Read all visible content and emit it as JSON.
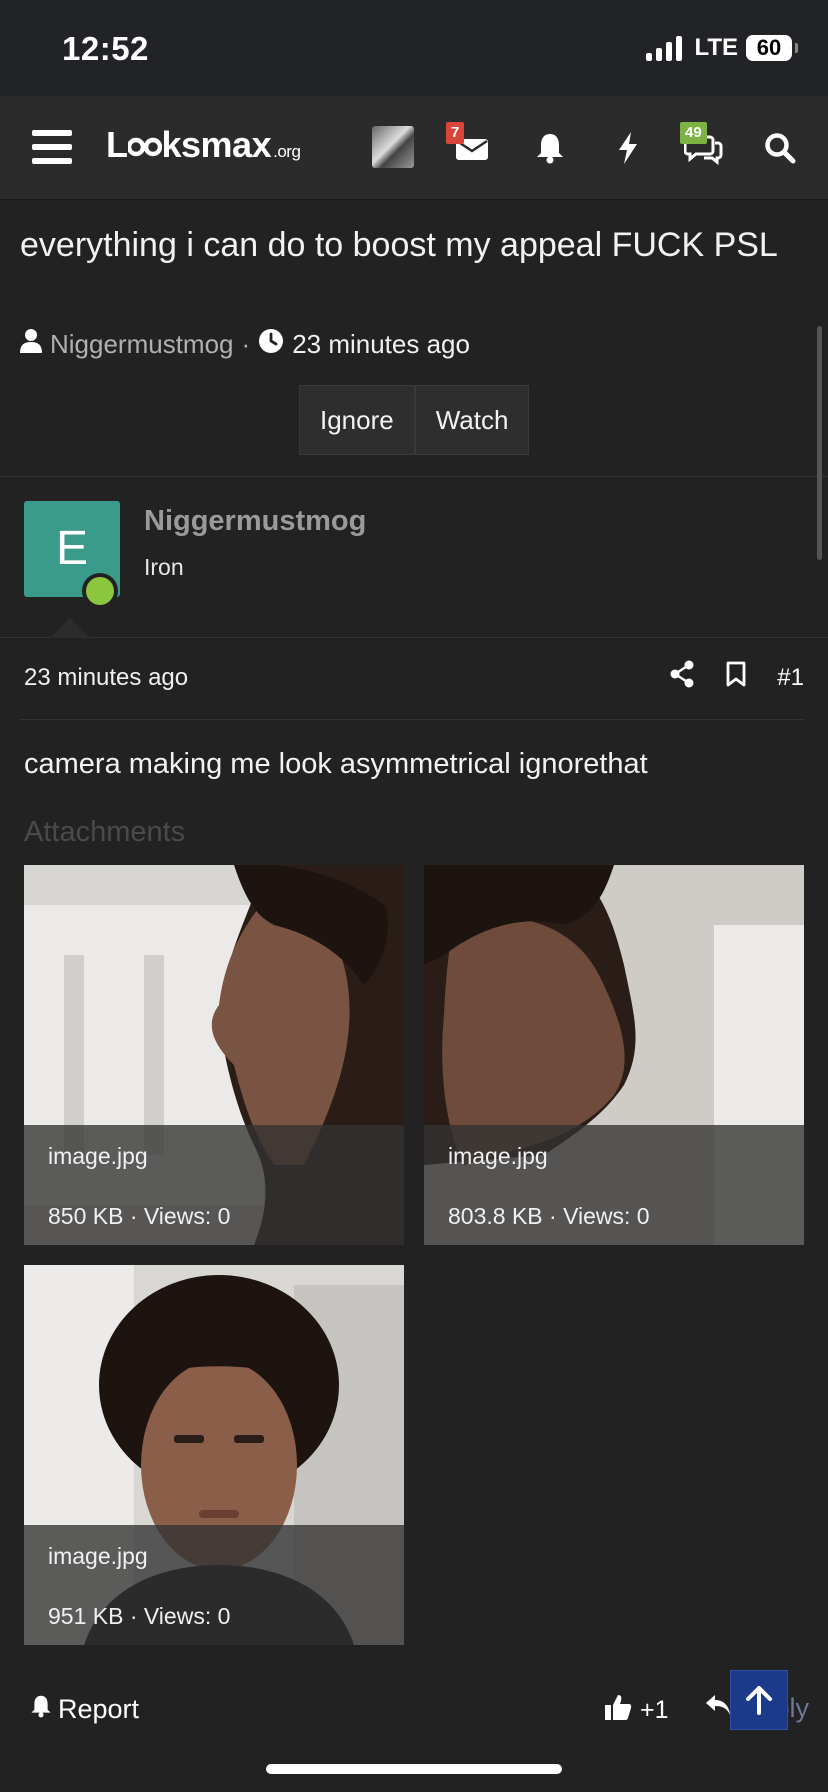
{
  "status_bar": {
    "time": "12:52",
    "network": "LTE",
    "battery": "60"
  },
  "nav": {
    "logo": "Lksmax",
    "logo_full": "Looksmax",
    "logo_suffix": ".org",
    "inbox_badge": "7",
    "chats_badge": "49",
    "colors": {
      "inbox_badge": "#d9453a",
      "chats_badge": "#7cb342"
    }
  },
  "thread": {
    "title": "everything i can do to boost my appeal FUCK PSL",
    "author": "Niggermustmog",
    "time": "23 minutes ago",
    "ignore_label": "Ignore",
    "watch_label": "Watch"
  },
  "user": {
    "initial": "E",
    "name": "Niggermustmog",
    "rank": "Iron",
    "colors": {
      "avatar": "#3a9b8a",
      "online": "#8cc63f"
    }
  },
  "post": {
    "time": "23 minutes ago",
    "number": "#1",
    "body": "camera making me look asymmetrical ignorethat",
    "attachments_label": "Attachments",
    "attachments": [
      {
        "name": "image.jpg",
        "meta": "850 KB · Views: 0"
      },
      {
        "name": "image.jpg",
        "meta": "803.8 KB · Views: 0"
      },
      {
        "name": "image.jpg",
        "meta": "951 KB · Views: 0"
      }
    ]
  },
  "footer": {
    "report_label": "Report",
    "like_label": "+1",
    "reply_label": "Reply"
  }
}
